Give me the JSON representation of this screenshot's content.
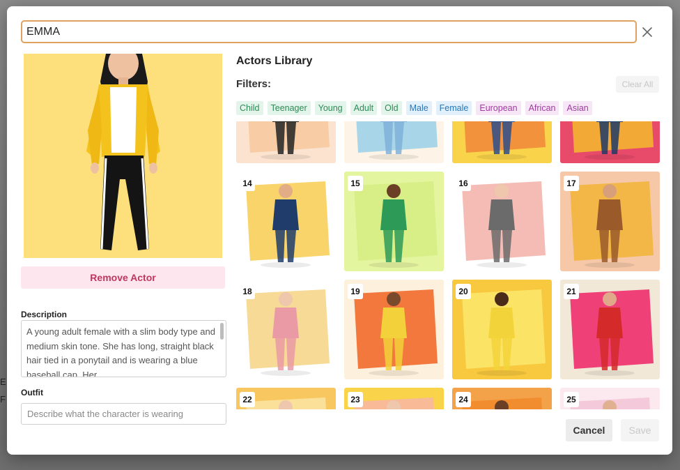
{
  "background": {
    "peek_letters": [
      "E",
      "F"
    ]
  },
  "modal": {
    "name_value": "EMMA",
    "actor": {
      "remove_label": "Remove Actor",
      "description_label": "Description",
      "description_text": "A young adult female with a slim body type and medium skin tone. She has long, straight black hair tied in a ponytail and is wearing a blue baseball cap. Her",
      "outfit_label": "Outfit",
      "outfit_placeholder": "Describe what the character is wearing",
      "outfit_value": ""
    },
    "library": {
      "title": "Actors Library",
      "filters_label": "Filters:",
      "clear_all_label": "Clear All",
      "tags": [
        {
          "label": "Child",
          "bg": "#e3f5ea",
          "fg": "#2e8a56"
        },
        {
          "label": "Teenager",
          "bg": "#e3f5ea",
          "fg": "#2e8a56"
        },
        {
          "label": "Young",
          "bg": "#e3f5ea",
          "fg": "#2e8a56"
        },
        {
          "label": "Adult",
          "bg": "#e3f5ea",
          "fg": "#2e8a56"
        },
        {
          "label": "Old",
          "bg": "#e3f5ea",
          "fg": "#2e8a56"
        },
        {
          "label": "Male",
          "bg": "#e2f0fb",
          "fg": "#2a76b5"
        },
        {
          "label": "Female",
          "bg": "#e2f0fb",
          "fg": "#2a76b5"
        },
        {
          "label": "European",
          "bg": "#f6e6f6",
          "fg": "#a03ba0"
        },
        {
          "label": "African",
          "bg": "#f6e6f6",
          "fg": "#a03ba0"
        },
        {
          "label": "Asian",
          "bg": "#f6e6f6",
          "fg": "#a03ba0"
        }
      ],
      "actors": [
        {
          "number": "",
          "bg": "#fbe3cf",
          "paint": "#f7c9a0",
          "outfit": "#222222",
          "skin": "#e6b08a"
        },
        {
          "number": "",
          "bg": "#fdf3e6",
          "paint": "#9fd3e8",
          "outfit": "#7fb0d8",
          "skin": "#e8bfa0"
        },
        {
          "number": "",
          "bg": "#f9d34a",
          "paint": "#f28b3c",
          "outfit": "#2b4c8a",
          "skin": "#d9a27e"
        },
        {
          "number": "",
          "bg": "#e84a6a",
          "paint": "#f3b431",
          "outfit": "#1f3a66",
          "skin": "#e4b896"
        },
        {
          "number": "14",
          "bg": "#ffffff",
          "paint": "#f8cf5a",
          "outfit": "#1f3c6b",
          "skin": "#e2ad86"
        },
        {
          "number": "15",
          "bg": "#e4f5a0",
          "paint": "#d6ee84",
          "outfit": "#2e9a57",
          "skin": "#6b3f26"
        },
        {
          "number": "16",
          "bg": "#ffffff",
          "paint": "#f4b5ad",
          "outfit": "#6b6b6b",
          "skin": "#efc7ad"
        },
        {
          "number": "17",
          "bg": "#f6c8a8",
          "paint": "#f2b53c",
          "outfit": "#9a5a2a",
          "skin": "#d8a07a"
        },
        {
          "number": "18",
          "bg": "#ffffff",
          "paint": "#f6d68a",
          "outfit": "#e99aa5",
          "skin": "#efc7ad"
        },
        {
          "number": "19",
          "bg": "#fdf0dc",
          "paint": "#f26a2c",
          "outfit": "#f2d13a",
          "skin": "#7a4a2c"
        },
        {
          "number": "20",
          "bg": "#f8c83e",
          "paint": "#fbe66a",
          "outfit": "#f3d33a",
          "skin": "#4a2b1a"
        },
        {
          "number": "21",
          "bg": "#f2e8d8",
          "paint": "#ee2f6d",
          "outfit": "#d42a2a",
          "skin": "#e0a98a"
        },
        {
          "number": "22",
          "bg": "#f8c760",
          "paint": "#fbe2a0",
          "outfit": "#888888",
          "skin": "#efc7ad"
        },
        {
          "number": "23",
          "bg": "#f9d34a",
          "paint": "#f7b7a0",
          "outfit": "#e2782e",
          "skin": "#efc7ad"
        },
        {
          "number": "24",
          "bg": "#f4a24a",
          "paint": "#f28b2c",
          "outfit": "#2b2b2b",
          "skin": "#6b3f26"
        },
        {
          "number": "25",
          "bg": "#fbe9ef",
          "paint": "#f3c7d8",
          "outfit": "#222222",
          "skin": "#e0b090"
        }
      ]
    },
    "footer": {
      "cancel_label": "Cancel",
      "save_label": "Save"
    }
  },
  "colors": {
    "input_focus_border": "#e0a15f",
    "remove_bg": "#fde6ee",
    "remove_fg": "#c0355f",
    "portrait_bg": "#fde07c"
  },
  "icons": {
    "close": "close-icon"
  }
}
